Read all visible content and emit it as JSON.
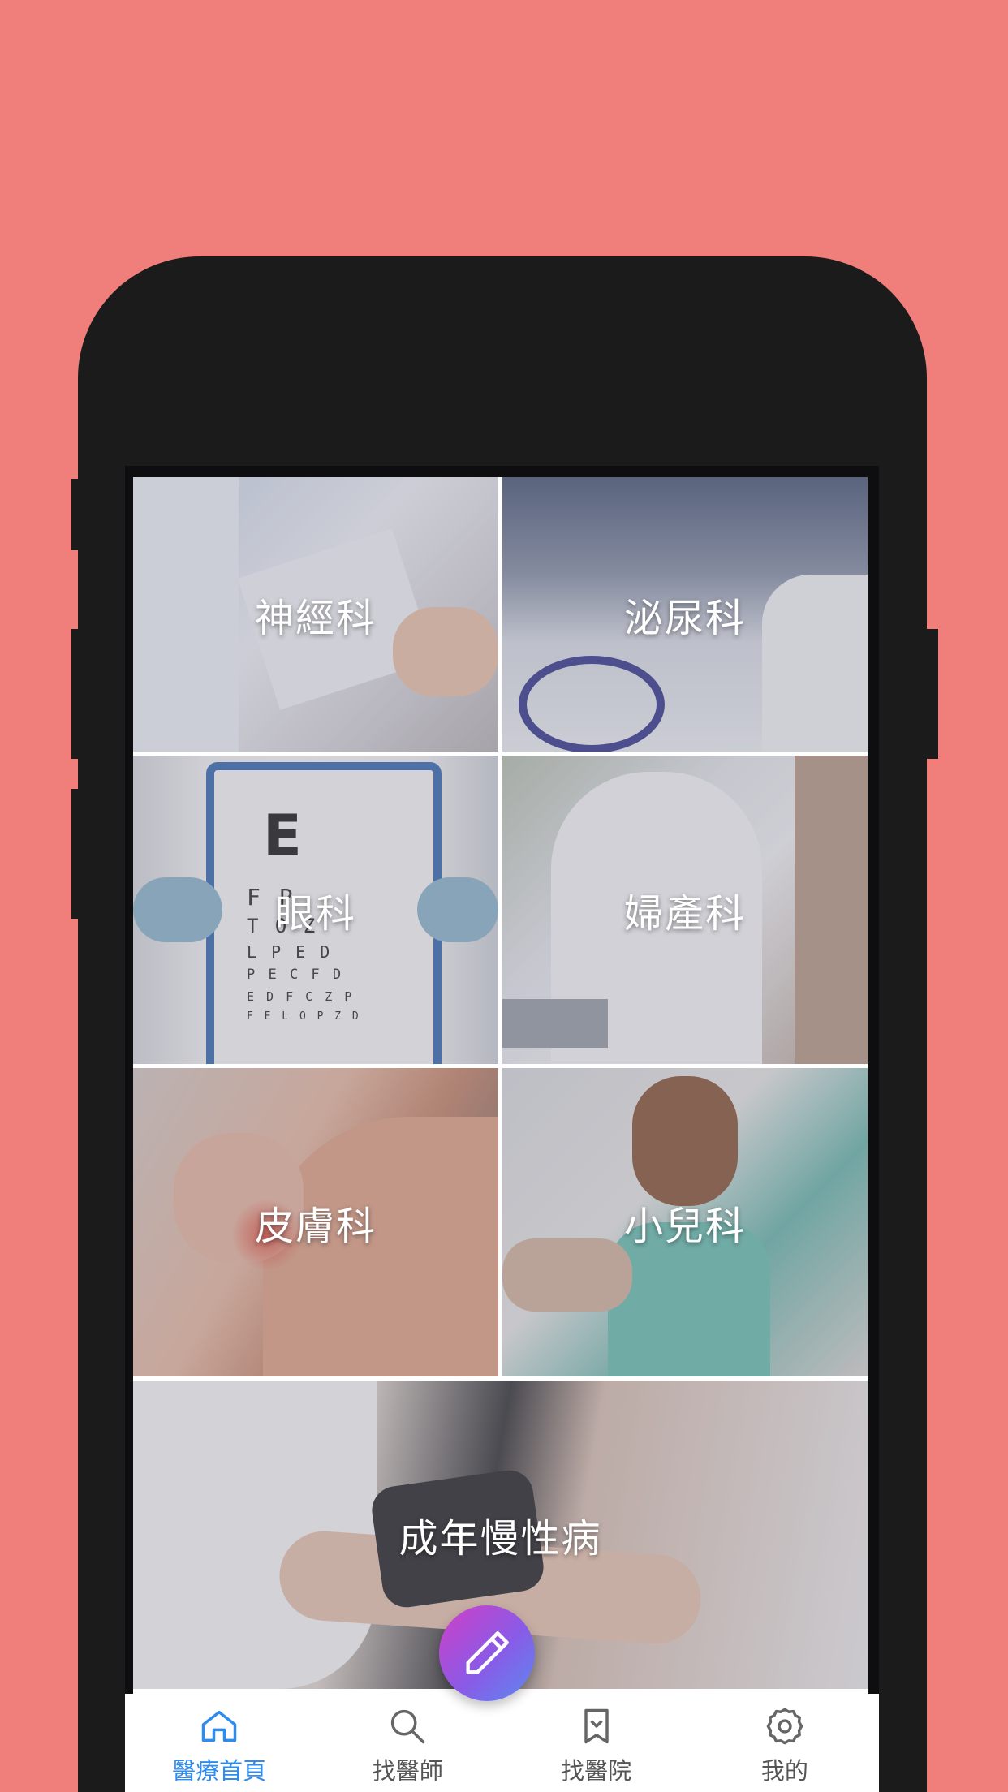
{
  "colors": {
    "page_background": "#F07E7B",
    "phone_frame": "#1B1B1B",
    "active_tab": "#2E8CF0",
    "inactive_tab": "#555555",
    "fab_gradient": [
      "#d13fc7",
      "#8a5ae6",
      "#5c89f0"
    ]
  },
  "categories": [
    {
      "label": "神經科"
    },
    {
      "label": "泌尿科"
    },
    {
      "label": "眼科"
    },
    {
      "label": "婦產科"
    },
    {
      "label": "皮膚科"
    },
    {
      "label": "小兒科"
    },
    {
      "label": "成年慢性病"
    }
  ],
  "eye_chart": {
    "letter": "E",
    "lines": [
      "F P",
      "T O Z",
      "L P E D",
      "P E C F D",
      "E D F C Z P",
      "F E L O P Z D"
    ]
  },
  "fab": {
    "icon": "pencil-icon"
  },
  "tabbar": {
    "tabs": [
      {
        "label": "醫療首頁",
        "icon": "home-icon",
        "active": true
      },
      {
        "label": "找醫師",
        "icon": "search-icon",
        "active": false
      },
      {
        "label": "找醫院",
        "icon": "bookmark-icon",
        "active": false
      },
      {
        "label": "我的",
        "icon": "gear-icon",
        "active": false
      }
    ]
  }
}
